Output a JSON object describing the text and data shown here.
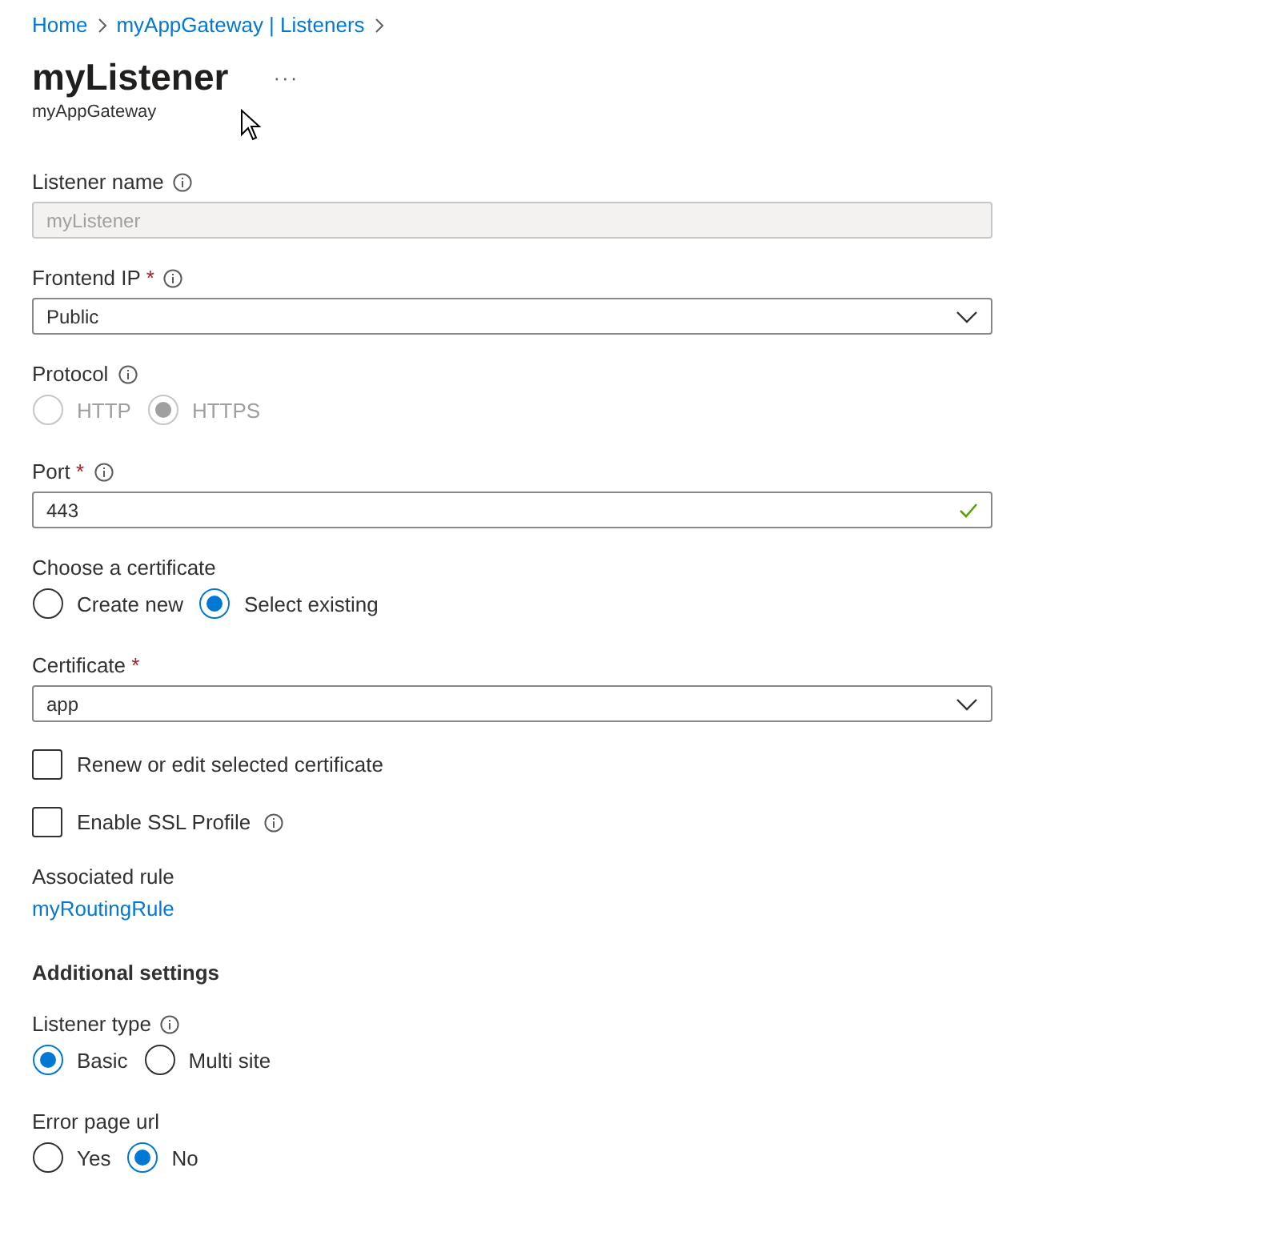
{
  "breadcrumb": [
    {
      "label": "Home"
    },
    {
      "label": "myAppGateway | Listeners"
    }
  ],
  "title": "myListener",
  "more": "···",
  "subtitle": "myAppGateway",
  "fields": [
    {
      "kind": "text",
      "label": "Listener name",
      "info": true,
      "value": "myListener",
      "disabled": true,
      "valid": false
    },
    {
      "kind": "select",
      "label": "Frontend IP",
      "required_mark": "*",
      "info": true,
      "value": "Public"
    },
    {
      "kind": "radio",
      "label": "Protocol",
      "info": true,
      "disabled": true,
      "options": [
        {
          "label": "HTTP",
          "selected": false
        },
        {
          "label": "HTTPS",
          "selected": true
        }
      ]
    },
    {
      "kind": "text",
      "label": "Port",
      "required_mark": "*",
      "info": true,
      "value": "443",
      "disabled": false,
      "valid": true
    },
    {
      "kind": "radio",
      "label": "Choose a certificate",
      "info": false,
      "disabled": false,
      "options": [
        {
          "label": "Create new",
          "selected": false
        },
        {
          "label": "Select existing",
          "selected": true
        }
      ]
    },
    {
      "kind": "select",
      "label": "Certificate",
      "required_mark": "*",
      "info": false,
      "value": "app"
    },
    {
      "kind": "checkbox",
      "label": "Renew or edit selected certificate",
      "info": false,
      "checked": false
    },
    {
      "kind": "checkbox",
      "label": "Enable SSL Profile",
      "info": true,
      "checked": false
    },
    {
      "kind": "link",
      "label": "Associated rule",
      "link": "myRoutingRule"
    },
    {
      "kind": "heading",
      "label": "Additional settings"
    },
    {
      "kind": "radio",
      "label": "Listener type",
      "info": true,
      "disabled": false,
      "options": [
        {
          "label": "Basic",
          "selected": true
        },
        {
          "label": "Multi site",
          "selected": false
        }
      ]
    },
    {
      "kind": "radio",
      "label": "Error page url",
      "info": false,
      "disabled": false,
      "options": [
        {
          "label": "Yes",
          "selected": false
        },
        {
          "label": "No",
          "selected": true
        }
      ]
    }
  ]
}
